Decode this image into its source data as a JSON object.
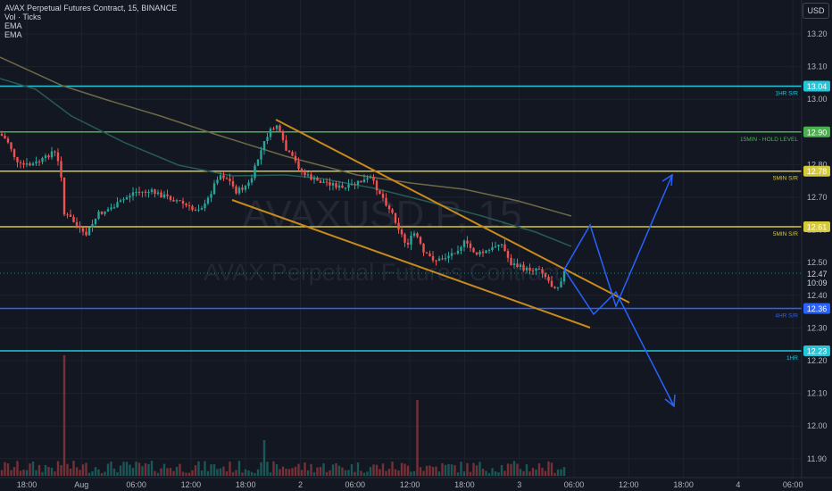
{
  "header": {
    "title": "AVAX Perpetual Futures Contract, 15, BINANCE",
    "indicators": [
      "Vol · Ticks",
      "EMA",
      "EMA"
    ],
    "currency_button": "USD"
  },
  "watermark": {
    "ticker": "AVAXUSD.P, 15",
    "name": "AVAX Perpetual Futures Contract"
  },
  "colors": {
    "background": "#131722",
    "up": "#26a69a",
    "down": "#ef5350",
    "channel": "#c98a1c",
    "projection": "#2962ff",
    "ema_slow": "#6e6a47",
    "ema_fast": "#275b56"
  },
  "price_axis": {
    "ticks": [
      "13.20",
      "13.10",
      "13.00",
      "12.90",
      "12.80",
      "12.70",
      "12.60",
      "12.50",
      "12.40",
      "12.30",
      "12.20",
      "12.10",
      "12.00",
      "11.90"
    ],
    "current_price": "12.47",
    "countdown": "10:09"
  },
  "time_axis": {
    "labels": [
      "18:00",
      "Aug",
      "06:00",
      "12:00",
      "18:00",
      "2",
      "06:00",
      "12:00",
      "18:00",
      "3",
      "06:00",
      "12:00",
      "18:00",
      "4",
      "06:00"
    ]
  },
  "levels": [
    {
      "price": 13.04,
      "value": "13.04",
      "label": "1HR S/R",
      "color": "#26c6da"
    },
    {
      "price": 12.9,
      "value": "12.90",
      "label": "15MIN - HOLD LEVEL",
      "color": "#4caf50"
    },
    {
      "price": 12.78,
      "value": "12.78",
      "label": "5MIN S/R",
      "color": "#d6c93a"
    },
    {
      "price": 12.61,
      "value": "12.61",
      "label": "5MIN S/R",
      "color": "#d6c93a"
    },
    {
      "price": 12.36,
      "value": "12.36",
      "label": "4HR S/R",
      "color": "#2962ff"
    },
    {
      "price": 12.23,
      "value": "12.23",
      "label": "1HR",
      "color": "#26c6da"
    }
  ]
}
